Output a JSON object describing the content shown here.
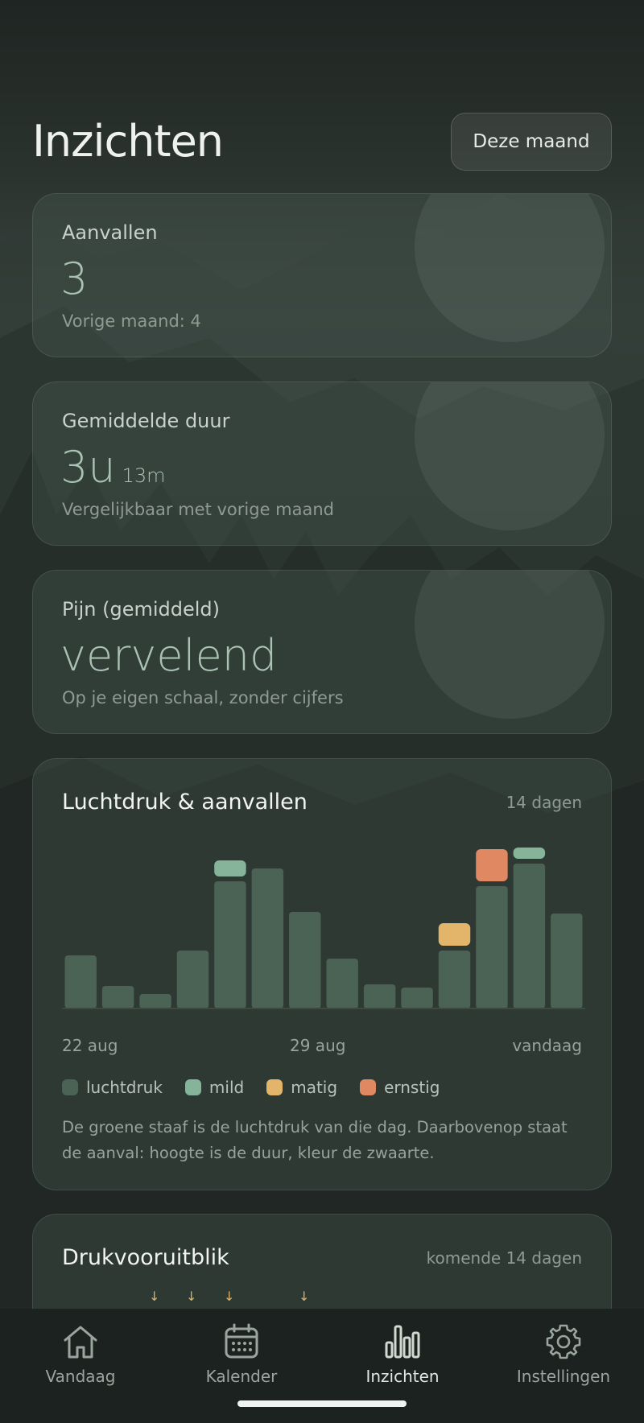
{
  "header": {
    "title": "Inzichten",
    "period_button": "Deze maand"
  },
  "stats": {
    "attacks": {
      "label": "Aanvallen",
      "value": "3",
      "sub": "Vorige maand: 4"
    },
    "duration": {
      "label": "Gemiddelde duur",
      "value": "3u",
      "value_small": "13m",
      "sub": "Vergelijkbaar met vorige maand"
    },
    "pain": {
      "label": "Pijn (gemiddeld)",
      "value": "vervelend",
      "sub": "Op je eigen schaal, zonder cijfers"
    }
  },
  "chart": {
    "title": "Luchtdruk & aanvallen",
    "range": "14 dagen",
    "x_labels": {
      "start": "22 aug",
      "mid": "29 aug",
      "end": "vandaag"
    },
    "legend": [
      {
        "label": "luchtdruk",
        "color": "#4a6354"
      },
      {
        "label": "mild",
        "color": "#86b49a"
      },
      {
        "label": "matig",
        "color": "#e2b56a"
      },
      {
        "label": "ernstig",
        "color": "#e08862"
      }
    ],
    "description": "De groene staaf is de luchtdruk van die dag. Daarbovenop staat de aanval: hoogte is de duur, kleur de zwaarte."
  },
  "chart_data": {
    "type": "bar",
    "categories": [
      "22 aug",
      "",
      "",
      "",
      "",
      "",
      "",
      "29 aug",
      "",
      "",
      "",
      "",
      "",
      "vandaag"
    ],
    "series": [
      {
        "name": "luchtdruk",
        "values": [
          0.33,
          0.14,
          0.09,
          0.36,
          0.79,
          0.87,
          0.6,
          0.31,
          0.15,
          0.13,
          0.36,
          0.76,
          0.9,
          0.59
        ]
      },
      {
        "name": "aanval",
        "values": [
          0,
          0,
          0,
          0,
          0.1,
          0,
          0,
          0,
          0,
          0,
          0.14,
          0.2,
          0.07,
          0
        ],
        "severity": [
          null,
          null,
          null,
          null,
          "mild",
          null,
          null,
          null,
          null,
          null,
          "matig",
          "ernstig",
          "mild",
          null
        ]
      }
    ],
    "colors": {
      "luchtdruk": "#4a6354",
      "mild": "#86b49a",
      "matig": "#e2b56a",
      "ernstig": "#e08862"
    }
  },
  "forecast": {
    "title": "Drukvooruitblik",
    "range": "komende 14 dagen",
    "arrow_glyph": "↓"
  },
  "tabs": [
    {
      "label": "Vandaag",
      "icon": "home-icon"
    },
    {
      "label": "Kalender",
      "icon": "calendar-icon"
    },
    {
      "label": "Inzichten",
      "icon": "bar-chart-icon"
    },
    {
      "label": "Instellingen",
      "icon": "gear-icon"
    }
  ]
}
